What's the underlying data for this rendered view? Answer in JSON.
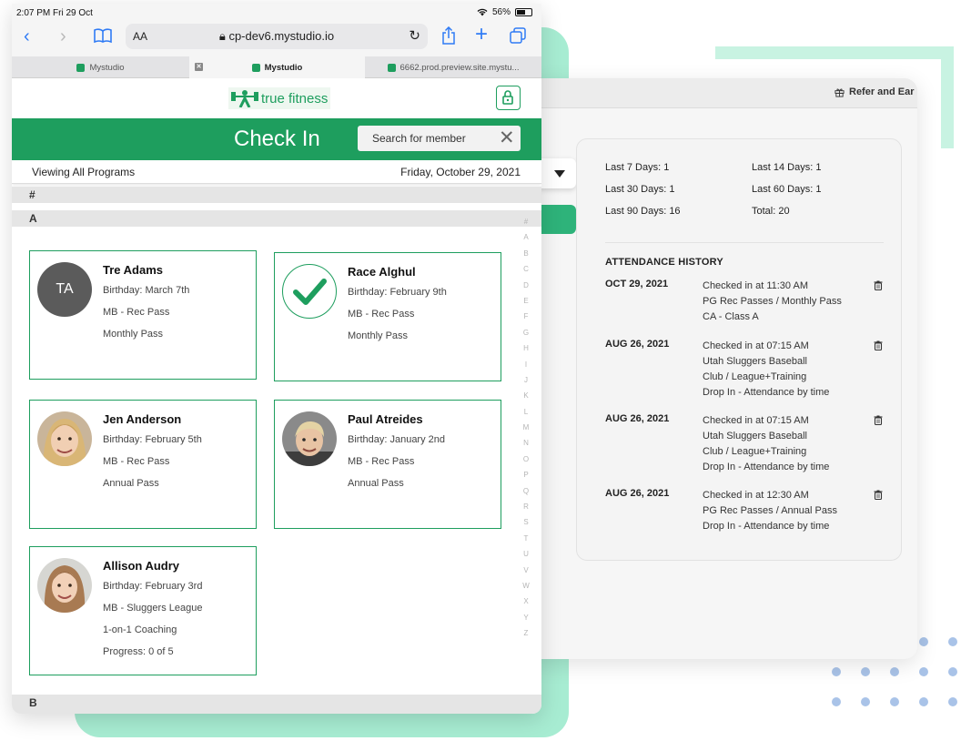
{
  "status_bar": {
    "time": "2:07 PM  Fri 29 Oct",
    "wifi": "wifi-icon",
    "battery": "56%"
  },
  "browser": {
    "font_size_label": "AA",
    "url": "cp-dev6.mystudio.io",
    "tabs": [
      {
        "label": "Mystudio"
      },
      {
        "label": "Mystudio"
      },
      {
        "label": "6662.prod.preview.site.mystu..."
      }
    ]
  },
  "app": {
    "logo_text": "true fitness",
    "checkin_title": "Check In",
    "search_placeholder": "Search for member",
    "viewing_label": "Viewing All Programs",
    "date_label": "Friday, October 29, 2021",
    "sections": [
      "#",
      "A",
      "B"
    ],
    "members": [
      {
        "name": "Tre Adams",
        "avatar_initials": "TA",
        "birthday": "Birthday: March 7th",
        "lines": [
          "MB - Rec Pass",
          "Monthly Pass"
        ]
      },
      {
        "name": "Race Alghul",
        "birthday": "Birthday: February 9th",
        "lines": [
          "MB - Rec Pass",
          "Monthly Pass"
        ]
      },
      {
        "name": "Jen Anderson",
        "birthday": "Birthday: February 5th",
        "lines": [
          "MB - Rec Pass",
          "Annual Pass"
        ]
      },
      {
        "name": "Paul Atreides",
        "birthday": "Birthday: January 2nd",
        "lines": [
          "MB - Rec Pass",
          "Annual Pass"
        ]
      },
      {
        "name": "Allison Audry",
        "birthday": "Birthday: February 3rd",
        "lines": [
          "MB - Sluggers League",
          "1-on-1 Coaching",
          "Progress:  0 of 5"
        ]
      }
    ],
    "az_index": [
      "#",
      "A",
      "B",
      "C",
      "D",
      "E",
      "F",
      "G",
      "H",
      "I",
      "J",
      "K",
      "L",
      "M",
      "N",
      "O",
      "P",
      "Q",
      "R",
      "S",
      "T",
      "U",
      "V",
      "W",
      "X",
      "Y",
      "Z"
    ]
  },
  "back_panel": {
    "refer_label": "Refer and Ear",
    "stats": {
      "last7": "Last 7 Days: 1",
      "last14": "Last 14 Days: 1",
      "last30": "Last 30 Days: 1",
      "last60": "Last 60 Days: 1",
      "last90": "Last 90 Days: 16",
      "total": "Total: 20"
    },
    "history_title": "ATTENDANCE HISTORY",
    "history": [
      {
        "date": "OCT 29, 2021",
        "lines": [
          "Checked in at 11:30 AM",
          "PG Rec Passes / Monthly Pass",
          "CA - Class A"
        ]
      },
      {
        "date": "AUG 26, 2021",
        "lines": [
          "Checked in at 07:15 AM",
          "Utah Sluggers Baseball",
          "Club / League+Training",
          "Drop In - Attendance by time"
        ]
      },
      {
        "date": "AUG 26, 2021",
        "lines": [
          "Checked in at 07:15 AM",
          "Utah Sluggers Baseball",
          "Club / League+Training",
          "Drop In - Attendance by time"
        ]
      },
      {
        "date": "AUG 26, 2021",
        "lines": [
          "Checked in at 12:30 AM",
          "PG Rec Passes / Annual Pass",
          "Drop In - Attendance by time"
        ]
      }
    ]
  },
  "colors": {
    "brand_green": "#1e9e5e",
    "accent_green": "#2eb37a",
    "mint": "#a7ecd2",
    "ios_blue": "#2f7bf5"
  }
}
